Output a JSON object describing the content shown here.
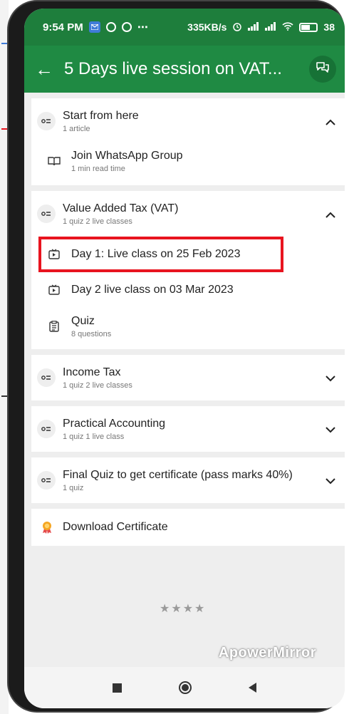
{
  "status_bar": {
    "time": "9:54 PM",
    "extra": "⋯",
    "network_speed": "335KB/s",
    "battery": "38"
  },
  "app_bar": {
    "title": "5 Days live session on VAT..."
  },
  "sections": [
    {
      "title": "Start from here",
      "subtitle": "1 article",
      "expanded": true,
      "items": [
        {
          "title": "Join WhatsApp Group",
          "subtitle": "1 min read time",
          "icon": "book-icon"
        }
      ]
    },
    {
      "title": "Value Added Tax (VAT)",
      "subtitle": "1 quiz 2 live classes",
      "expanded": true,
      "items": [
        {
          "title": "Day 1: Live class on 25 Feb 2023",
          "icon": "live-class-icon",
          "highlighted": true
        },
        {
          "title": "Day 2 live class on 03 Mar 2023",
          "icon": "live-class-icon"
        },
        {
          "title": "Quiz",
          "subtitle": "8 questions",
          "icon": "quiz-clipboard-icon"
        }
      ]
    },
    {
      "title": "Income Tax",
      "subtitle": "1 quiz 2 live classes",
      "expanded": false
    },
    {
      "title": "Practical Accounting",
      "subtitle": "1 quiz 1 live class",
      "expanded": false
    },
    {
      "title": "Final Quiz to get certificate (pass marks 40%)",
      "subtitle": "1 quiz",
      "expanded": false
    }
  ],
  "download_certificate": {
    "label": "Download Certificate",
    "icon": "certificate-badge-icon"
  },
  "watermark": "ApowerMirror",
  "colors": {
    "statusbar": "#1e7e3c",
    "appbar": "#1f8a43",
    "highlight": "#e8141f",
    "background": "#eeeeee"
  }
}
